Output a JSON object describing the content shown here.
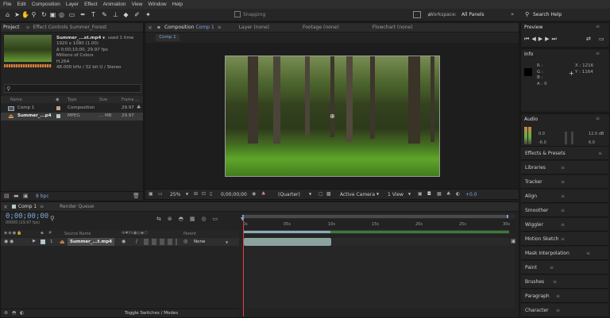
{
  "menu": [
    "File",
    "Edit",
    "Composition",
    "Layer",
    "Effect",
    "Animation",
    "View",
    "Window",
    "Help"
  ],
  "toolbar": {
    "snapping": "Snapping",
    "workspace_label": "Workspace:",
    "workspace_value": "All Panels",
    "search_help": "Search Help"
  },
  "project": {
    "tab_project": "Project",
    "tab_effect_controls": "Effect Controls Summer_Forest",
    "file_name": "Summer_...st.mp4",
    "used": ", used 1 time",
    "resolution": "1920 x 1080 (1.00)",
    "duration": "Δ 0;00;10;00, 29.97 fps",
    "colors": "Millions of Colors",
    "codec": "H.264",
    "audio": "48.000 kHz / 32 bit U / Stereo",
    "headers": {
      "name": "Name",
      "type": "Type",
      "size": "Size",
      "fps": "Frame ..."
    },
    "items": [
      {
        "name": "Comp 1",
        "type": "Composition",
        "size": "",
        "fps": "29.97"
      },
      {
        "name": "Summer_...p4",
        "type": "MPEG",
        "size": "... MB",
        "fps": "29.97"
      }
    ],
    "bpc": "8 bpc"
  },
  "viewer": {
    "tab_composition": "Composition",
    "comp_name": "Comp 1",
    "tab_layer": "Layer (none)",
    "tab_footage": "Footage (none)",
    "tab_flowchart": "Flowchart (none)",
    "subtab": "Comp 1",
    "zoom": "25%",
    "timecode": "0;00;00;00",
    "resolution": "(Quarter)",
    "camera": "Active Camera",
    "views": "1 View",
    "exposure": "+0.0"
  },
  "preview": {
    "title": "Preview"
  },
  "info": {
    "title": "Info",
    "r": "R :",
    "g": "G :",
    "b": "B :",
    "a": "A : 0",
    "x": "X : 1216",
    "y": "Y : 1164"
  },
  "audio": {
    "title": "Audio",
    "db_top": "0.0",
    "db_mid": "-6.0",
    "db_right_top": "12.0 dB",
    "db_right_mid": "6.0"
  },
  "panels": [
    "Effects & Presets",
    "Libraries",
    "Tracker",
    "Align",
    "Smoother",
    "Wiggler",
    "Motion Sketch",
    "Mask Interpolation",
    "Paint",
    "Brushes",
    "Paragraph",
    "Character"
  ],
  "timeline": {
    "tab_comp": "Comp 1",
    "tab_render": "Render Queue",
    "timecode": "0;00;00;00",
    "frame_info": "00000 (29.97 fps)",
    "col_source": "Source Name",
    "col_parent": "Parent",
    "layer_num": "1",
    "layer_name": "Summer_...t.mp4",
    "parent_value": "None",
    "toggle": "Toggle Switches / Modes",
    "ruler": [
      "0s",
      "05s",
      "10s",
      "15s",
      "20s",
      "25s",
      "30s"
    ]
  }
}
